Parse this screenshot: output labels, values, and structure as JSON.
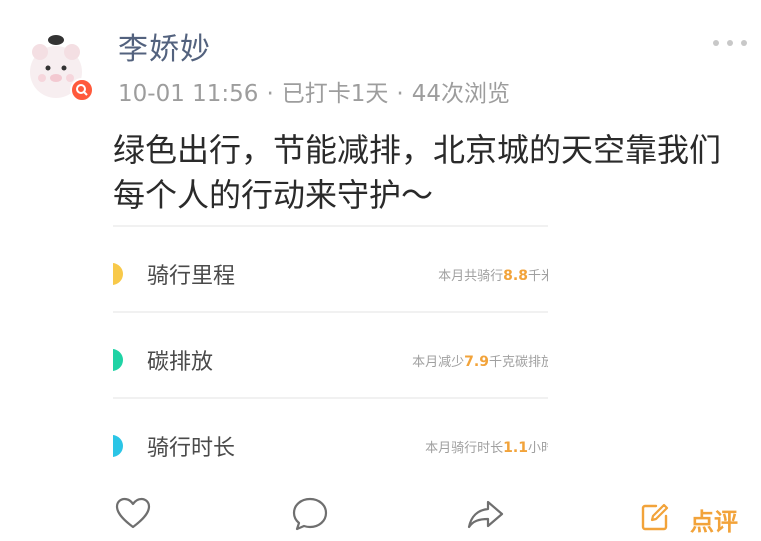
{
  "post": {
    "user_name": "李娇妙",
    "timestamp": "10-01 11:56",
    "checkin": "已打卡1天",
    "views": "44次浏览",
    "separator": "·",
    "content": "绿色出行，节能减排，北京城的天空靠我们每个人的行动来守护～"
  },
  "card": {
    "rows": [
      {
        "label": "骑行里程",
        "summary_prefix": "本月共骑行",
        "value": "8.8",
        "summary_suffix": "千米",
        "color": "#f8c94a"
      },
      {
        "label": "碳排放",
        "summary_prefix": "本月减少",
        "value": "7.9",
        "summary_suffix": "千克碳排放",
        "color": "#1fd3a5"
      },
      {
        "label": "骑行时长",
        "summary_prefix": "本月骑行时长",
        "value": "1.1",
        "summary_suffix": "小时",
        "color": "#2bc5e6"
      }
    ]
  },
  "actions": {
    "like_icon": "heart-icon",
    "comment_icon": "comment-icon",
    "share_icon": "share-icon",
    "review_icon": "edit-icon",
    "review_label": "点评",
    "accent_color": "#f2a33a"
  }
}
